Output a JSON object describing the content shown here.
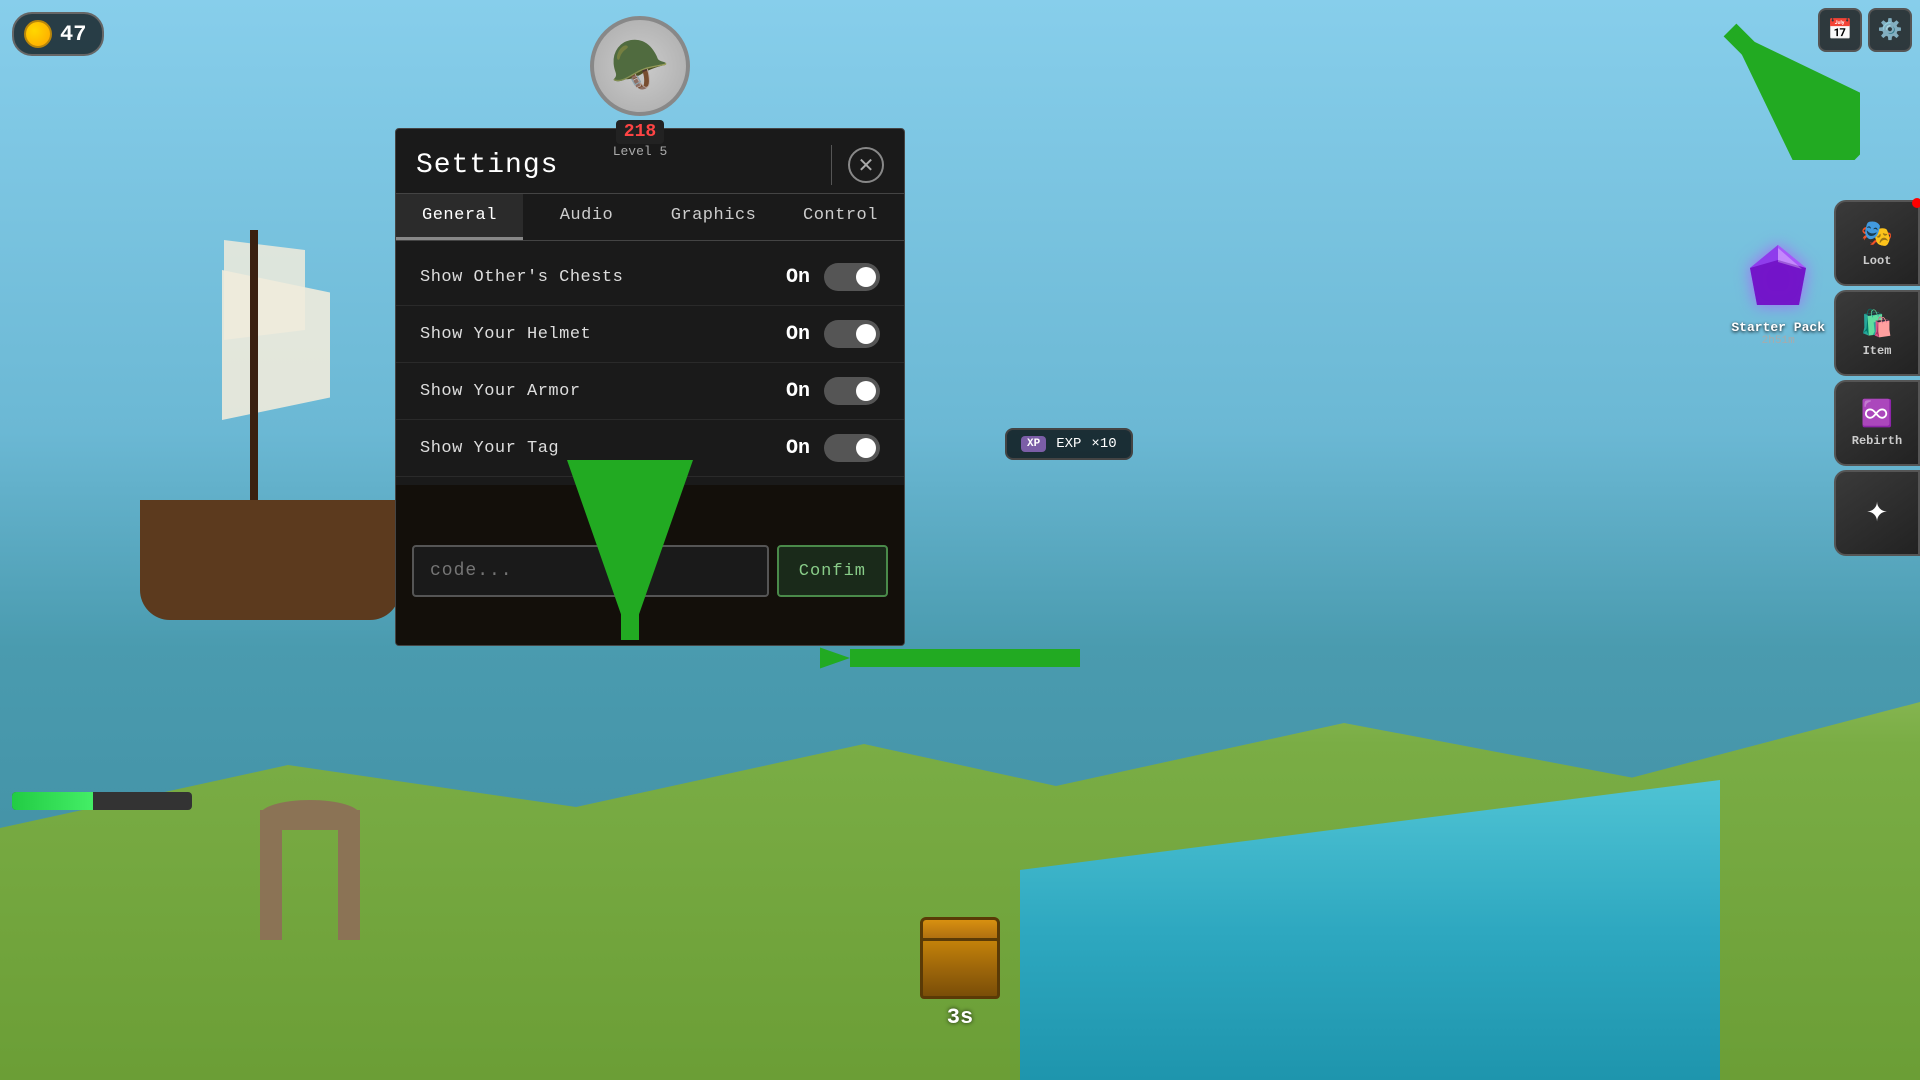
{
  "hud": {
    "coins": "47",
    "coin_label": "47"
  },
  "character": {
    "level_number": "218",
    "level_label": "Level 5"
  },
  "modal": {
    "title": "Settings",
    "close_label": "✕",
    "tabs": [
      {
        "id": "general",
        "label": "General",
        "active": true
      },
      {
        "id": "audio",
        "label": "Audio",
        "active": false
      },
      {
        "id": "graphics",
        "label": "Graphics",
        "active": false
      },
      {
        "id": "control",
        "label": "Control",
        "active": false
      }
    ],
    "settings": [
      {
        "id": "show-others-chests",
        "label": "Show Other's Chests",
        "value": "On",
        "enabled": true
      },
      {
        "id": "show-your-helmet",
        "label": "Show Your Helmet",
        "value": "On",
        "enabled": true
      },
      {
        "id": "show-your-armor",
        "label": "Show Your Armor",
        "value": "On",
        "enabled": true
      },
      {
        "id": "show-your-tag",
        "label": "Show Your Tag",
        "value": "On",
        "enabled": true
      }
    ],
    "code_placeholder": "code...",
    "confirm_label": "Confim"
  },
  "sidebar": {
    "starter_pack_label": "Starter Pack",
    "starter_pack_timer": "2h51m",
    "loot_label": "Loot",
    "item_label": "Item",
    "rebirth_label": "Rebirth"
  },
  "exp_bar": {
    "xp_badge": "XP",
    "label": "EXP",
    "multiplier": "×10"
  },
  "chest": {
    "timer": "3s"
  }
}
